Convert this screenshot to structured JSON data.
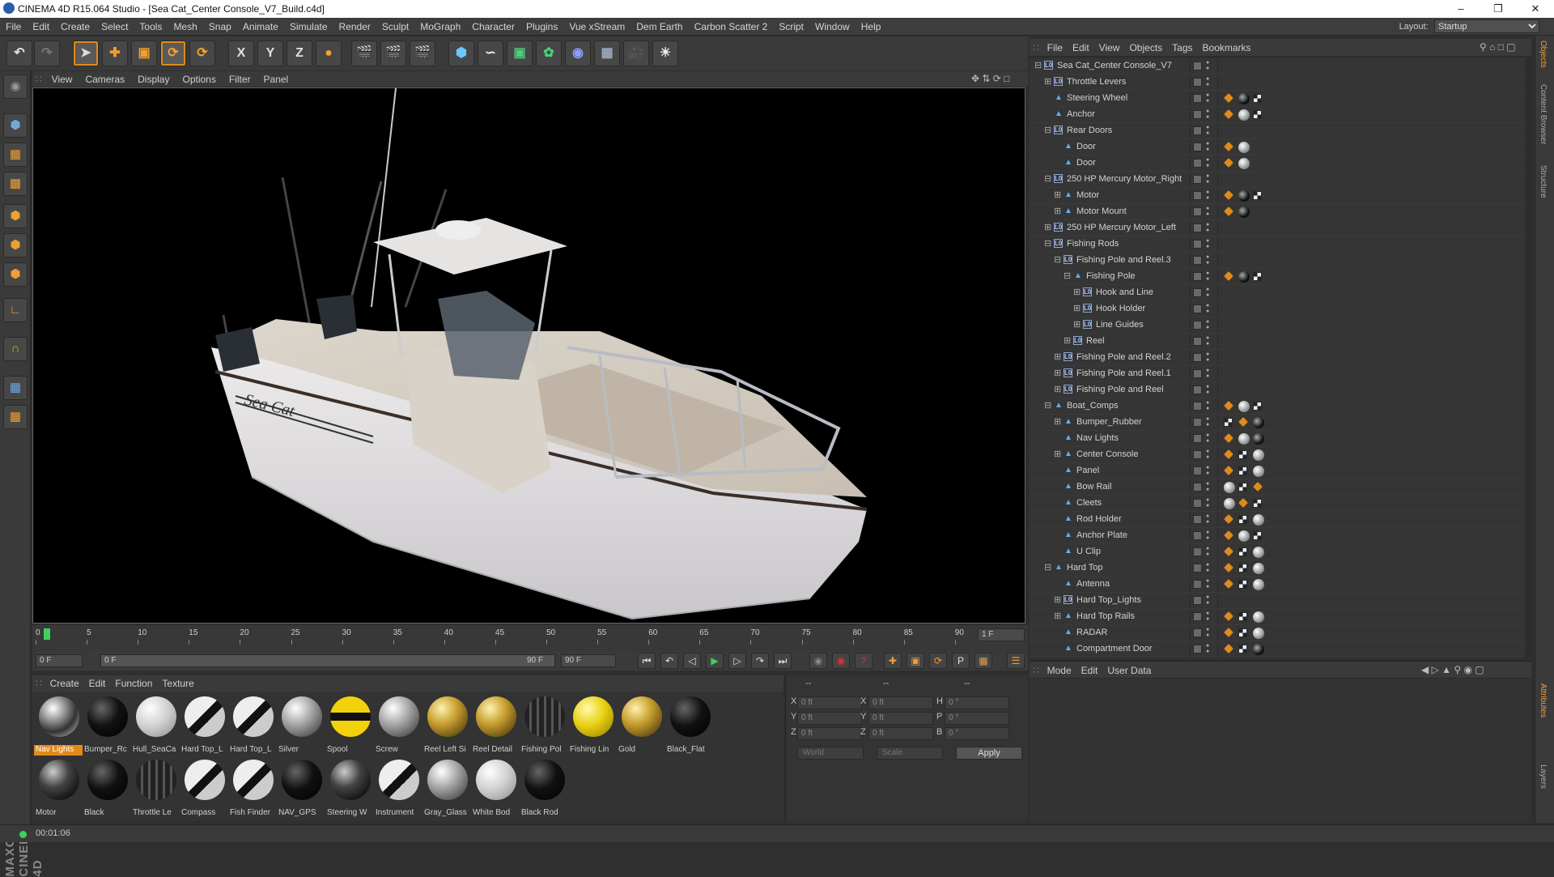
{
  "window": {
    "title": "CINEMA 4D R15.064 Studio - [Sea Cat_Center Console_V7_Build.c4d]"
  },
  "menubar": [
    "File",
    "Edit",
    "Create",
    "Select",
    "Tools",
    "Mesh",
    "Snap",
    "Animate",
    "Simulate",
    "Render",
    "Sculpt",
    "MoGraph",
    "Character",
    "Plugins",
    "Vue xStream",
    "Dem Earth",
    "Carbon Scatter 2",
    "Script",
    "Window",
    "Help"
  ],
  "layout": {
    "label": "Layout:",
    "value": "Startup"
  },
  "viewport_menu": [
    "View",
    "Cameras",
    "Display",
    "Options",
    "Filter",
    "Panel"
  ],
  "timeline": {
    "ticks": [
      "0",
      "5",
      "10",
      "15",
      "20",
      "25",
      "30",
      "35",
      "40",
      "45",
      "50",
      "55",
      "60",
      "65",
      "70",
      "75",
      "80",
      "85",
      "90"
    ],
    "current_frame": "1 F"
  },
  "playbar": {
    "start": "0 F",
    "range_start": "0 F",
    "range_end": "90 F",
    "end": "90 F"
  },
  "material_menu": [
    "Create",
    "Edit",
    "Function",
    "Texture"
  ],
  "materials": [
    {
      "name": "Nav Lights",
      "style": "chrome"
    },
    {
      "name": "Bumper_Rc",
      "style": "black"
    },
    {
      "name": "Hull_SeaCa",
      "style": "white"
    },
    {
      "name": "Hard Top_L",
      "style": "bw"
    },
    {
      "name": "Hard Top_L",
      "style": "bw"
    },
    {
      "name": "Silver",
      "style": "silver"
    },
    {
      "name": "Spool",
      "style": "yellowblack"
    },
    {
      "name": "Screw",
      "style": "silver"
    },
    {
      "name": "Reel Left Si",
      "style": "gold"
    },
    {
      "name": "Reel Detail",
      "style": "gold"
    },
    {
      "name": "Fishing Pol",
      "style": "darkstripe"
    },
    {
      "name": "Fishing Lin",
      "style": "yellow"
    },
    {
      "name": "Gold",
      "style": "gold"
    },
    {
      "name": "Black_Flat",
      "style": "black"
    },
    {
      "name": "Motor",
      "style": "darkchrome"
    },
    {
      "name": "Black",
      "style": "black"
    },
    {
      "name": "Throttle Le",
      "style": "darkstripe"
    },
    {
      "name": "Compass",
      "style": "bw"
    },
    {
      "name": "Fish Finder",
      "style": "bw"
    },
    {
      "name": "NAV_GPS",
      "style": "black"
    },
    {
      "name": "Steering W",
      "style": "darkchrome"
    },
    {
      "name": "Instrument",
      "style": "bw"
    },
    {
      "name": "Gray_Glass",
      "style": "silver"
    },
    {
      "name": "White Bod",
      "style": "white"
    },
    {
      "name": "Black Rod",
      "style": "black"
    }
  ],
  "coords": {
    "col1": "--",
    "col2": "--",
    "col3": "--",
    "rows": [
      {
        "a": "X",
        "av": "0 ft",
        "b": "X",
        "bv": "0 ft",
        "c": "H",
        "cv": "0 °"
      },
      {
        "a": "Y",
        "av": "0 ft",
        "b": "Y",
        "bv": "0 ft",
        "c": "P",
        "cv": "0 °"
      },
      {
        "a": "Z",
        "av": "0 ft",
        "b": "Z",
        "bv": "0 ft",
        "c": "B",
        "cv": "0 °"
      }
    ],
    "world": "World",
    "scale": "Scale",
    "apply": "Apply"
  },
  "object_menu": [
    "File",
    "Edit",
    "View",
    "Objects",
    "Tags",
    "Bookmarks"
  ],
  "objects": [
    {
      "name": "Sea Cat_Center Console_V7",
      "depth": 0,
      "type": "null",
      "exp": "-",
      "tags": []
    },
    {
      "name": "Throttle Levers",
      "depth": 1,
      "type": "null",
      "exp": "+",
      "tags": []
    },
    {
      "name": "Steering Wheel",
      "depth": 1,
      "type": "poly",
      "exp": "",
      "tags": [
        "ph",
        "blk",
        "chk"
      ]
    },
    {
      "name": "Anchor",
      "depth": 1,
      "type": "poly",
      "exp": "",
      "tags": [
        "ph",
        "gry",
        "chk"
      ]
    },
    {
      "name": "Rear Doors",
      "depth": 1,
      "type": "null",
      "exp": "-",
      "tags": []
    },
    {
      "name": "Door",
      "depth": 2,
      "type": "poly",
      "exp": "",
      "tags": [
        "ph",
        "gry"
      ]
    },
    {
      "name": "Door",
      "depth": 2,
      "type": "poly",
      "exp": "",
      "tags": [
        "ph",
        "gry"
      ]
    },
    {
      "name": "250 HP Mercury Motor_Right",
      "depth": 1,
      "type": "null",
      "exp": "-",
      "tags": []
    },
    {
      "name": "Motor",
      "depth": 2,
      "type": "poly",
      "exp": "+",
      "tags": [
        "ph",
        "blk",
        "chk"
      ]
    },
    {
      "name": "Motor Mount",
      "depth": 2,
      "type": "poly",
      "exp": "+",
      "tags": [
        "ph",
        "blk"
      ]
    },
    {
      "name": "250 HP Mercury Motor_Left",
      "depth": 1,
      "type": "null",
      "exp": "+",
      "tags": []
    },
    {
      "name": "Fishing Rods",
      "depth": 1,
      "type": "null",
      "exp": "-",
      "tags": []
    },
    {
      "name": "Fishing Pole and Reel.3",
      "depth": 2,
      "type": "null",
      "exp": "-",
      "tags": []
    },
    {
      "name": "Fishing Pole",
      "depth": 3,
      "type": "poly",
      "exp": "-",
      "tags": [
        "ph",
        "blk",
        "chk"
      ]
    },
    {
      "name": "Hook and Line",
      "depth": 4,
      "type": "null",
      "exp": "+",
      "tags": []
    },
    {
      "name": "Hook Holder",
      "depth": 4,
      "type": "null",
      "exp": "+",
      "tags": []
    },
    {
      "name": "Line Guides",
      "depth": 4,
      "type": "null",
      "exp": "+",
      "tags": []
    },
    {
      "name": "Reel",
      "depth": 3,
      "type": "null",
      "exp": "+",
      "tags": []
    },
    {
      "name": "Fishing Pole and Reel.2",
      "depth": 2,
      "type": "null",
      "exp": "+",
      "tags": []
    },
    {
      "name": "Fishing Pole and Reel.1",
      "depth": 2,
      "type": "null",
      "exp": "+",
      "tags": []
    },
    {
      "name": "Fishing Pole and Reel",
      "depth": 2,
      "type": "null",
      "exp": "+",
      "tags": []
    },
    {
      "name": "Boat_Comps",
      "depth": 1,
      "type": "poly",
      "exp": "-",
      "tags": [
        "ph",
        "gry",
        "chk"
      ]
    },
    {
      "name": "Bumper_Rubber",
      "depth": 2,
      "type": "poly",
      "exp": "+",
      "tags": [
        "chk",
        "ph",
        "blk"
      ]
    },
    {
      "name": "Nav Lights",
      "depth": 2,
      "type": "poly",
      "exp": "",
      "tags": [
        "ph",
        "gry",
        "blk"
      ]
    },
    {
      "name": "Center Console",
      "depth": 2,
      "type": "poly",
      "exp": "+",
      "tags": [
        "ph",
        "chk",
        "gry"
      ]
    },
    {
      "name": "Panel",
      "depth": 2,
      "type": "poly",
      "exp": "",
      "tags": [
        "ph",
        "chk",
        "gry"
      ]
    },
    {
      "name": "Bow Rail",
      "depth": 2,
      "type": "poly",
      "exp": "",
      "tags": [
        "gry",
        "chk",
        "ph"
      ]
    },
    {
      "name": "Cleets",
      "depth": 2,
      "type": "poly",
      "exp": "",
      "tags": [
        "gry",
        "ph",
        "chk"
      ]
    },
    {
      "name": "Rod Holder",
      "depth": 2,
      "type": "poly",
      "exp": "",
      "tags": [
        "ph",
        "chk",
        "gry"
      ]
    },
    {
      "name": "Anchor Plate",
      "depth": 2,
      "type": "poly",
      "exp": "",
      "tags": [
        "ph",
        "gry",
        "chk"
      ]
    },
    {
      "name": "U Clip",
      "depth": 2,
      "type": "poly",
      "exp": "",
      "tags": [
        "ph",
        "chk",
        "gry"
      ]
    },
    {
      "name": "Hard Top",
      "depth": 1,
      "type": "poly",
      "exp": "-",
      "tags": [
        "ph",
        "chk",
        "gry"
      ]
    },
    {
      "name": "Antenna",
      "depth": 2,
      "type": "poly",
      "exp": "",
      "tags": [
        "ph",
        "chk",
        "gry"
      ]
    },
    {
      "name": "Hard Top_Lights",
      "depth": 2,
      "type": "null",
      "exp": "+",
      "tags": []
    },
    {
      "name": "Hard Top Rails",
      "depth": 2,
      "type": "poly",
      "exp": "+",
      "tags": [
        "ph",
        "chk",
        "gry"
      ]
    },
    {
      "name": "RADAR",
      "depth": 2,
      "type": "poly",
      "exp": "",
      "tags": [
        "ph",
        "chk",
        "gry"
      ]
    },
    {
      "name": "Compartment Door",
      "depth": 2,
      "type": "poly",
      "exp": "",
      "tags": [
        "ph",
        "chk",
        "blk"
      ]
    }
  ],
  "attr_menu": [
    "Mode",
    "Edit",
    "User Data"
  ],
  "right_tabs": [
    "Objects",
    "Content Browser",
    "Structure",
    "Attributes",
    "Layers"
  ],
  "status": {
    "time": "00:01:06"
  },
  "maxon": "MAXON CINEMA 4D",
  "boat_text": "Sea Cat"
}
